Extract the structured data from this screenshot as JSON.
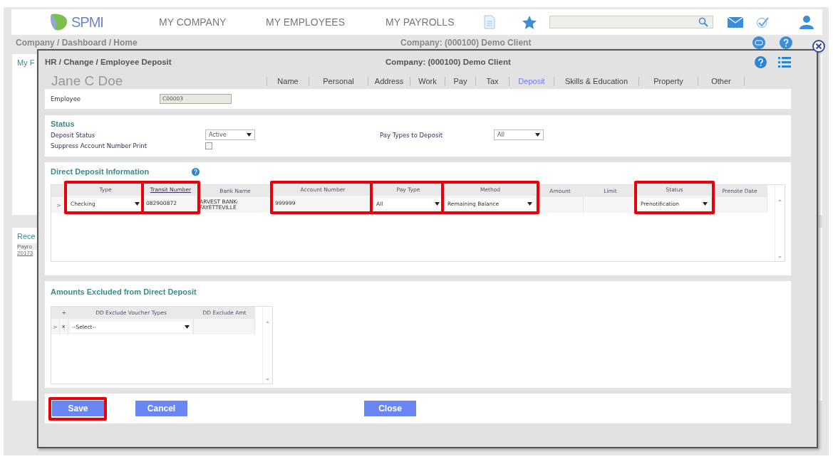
{
  "header": {
    "logo": "SPMI",
    "nav": [
      "MY COMPANY",
      "MY EMPLOYEES",
      "MY PAYROLLS"
    ]
  },
  "breadcrumb": {
    "path": "Company / Dashboard / Home",
    "company": "Company: (000100) Demo Client"
  },
  "background_cards": [
    {
      "title": "My F"
    },
    {
      "title": "Rece",
      "lines": [
        "Payro",
        "20173"
      ]
    }
  ],
  "modal": {
    "path": "HR / Change / Employee Deposit",
    "company": "Company: (000100) Demo Client",
    "employee_name": "Jane C Doe",
    "tabs": [
      {
        "label": "Name",
        "selected": false
      },
      {
        "label": "Personal",
        "selected": false
      },
      {
        "label": "Address",
        "selected": false
      },
      {
        "label": "Work",
        "selected": false
      },
      {
        "label": "Pay",
        "selected": false
      },
      {
        "label": "Tax",
        "selected": false
      },
      {
        "label": "Deposit",
        "selected": true
      },
      {
        "label": "Skills & Education",
        "selected": false
      },
      {
        "label": "Property",
        "selected": false
      },
      {
        "label": "Other",
        "selected": false
      }
    ],
    "employee": {
      "label": "Employee",
      "value": "C00003"
    },
    "status": {
      "title": "Status",
      "fields": [
        {
          "kind": "select",
          "label": "Deposit Status",
          "value": "Active"
        },
        {
          "kind": "checkbox",
          "label": "Suppress Account Number Print",
          "checked": false
        },
        {
          "kind": "select",
          "label": "Pay Types to Deposit",
          "value": "All"
        }
      ]
    },
    "direct_deposit": {
      "title": "Direct Deposit Information",
      "row_marker": ">",
      "columns": [
        {
          "label": "Type",
          "highlighted": true,
          "cell": {
            "kind": "select",
            "value": "Checking"
          }
        },
        {
          "label": "Transit Number",
          "kind": "link",
          "highlighted": true,
          "cell": {
            "kind": "text",
            "value": "082900872"
          }
        },
        {
          "label": "Bank Name",
          "highlighted": false,
          "cell": {
            "kind": "text",
            "value": "ARVEST BANK-FAYETTEVILLE"
          }
        },
        {
          "label": "Account Number",
          "highlighted": true,
          "cell": {
            "kind": "text",
            "value": "999999"
          }
        },
        {
          "label": "Pay Type",
          "highlighted": true,
          "cell": {
            "kind": "select",
            "value": "All"
          }
        },
        {
          "label": "Method",
          "highlighted": true,
          "cell": {
            "kind": "select",
            "value": "Remaining Balance"
          }
        },
        {
          "label": "Amount",
          "highlighted": false
        },
        {
          "label": "Limit",
          "highlighted": false
        },
        {
          "label": "Status",
          "highlighted": true,
          "cell": {
            "kind": "select",
            "value": "Prenotification"
          }
        },
        {
          "label": "Prenote Date",
          "highlighted": false
        }
      ]
    },
    "excluded": {
      "title": "Amounts Excluded from Direct Deposit",
      "row_marker": ">",
      "columns": [
        {
          "label": "+",
          "cell": {
            "kind": "text",
            "value": "x"
          }
        },
        {
          "label": "DD Exclude Voucher Types",
          "cell": {
            "kind": "select",
            "value": "--Select--"
          }
        },
        {
          "label": "DD Exclude Amt"
        }
      ]
    },
    "buttons": [
      {
        "label": "Save",
        "highlighted": true
      },
      {
        "label": "Cancel",
        "highlighted": false
      },
      {
        "label": "Close",
        "highlighted": false
      }
    ]
  }
}
